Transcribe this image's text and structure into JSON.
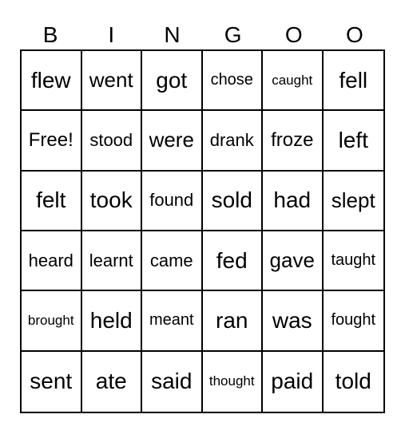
{
  "header": {
    "letters": [
      "B",
      "I",
      "N",
      "G",
      "O",
      "O"
    ]
  },
  "card": {
    "rows": [
      [
        "flew",
        "went",
        "got",
        "chose",
        "caught",
        "fell"
      ],
      [
        "Free!",
        "stood",
        "were",
        "drank",
        "froze",
        "left"
      ],
      [
        "felt",
        "took",
        "found",
        "sold",
        "had",
        "slept"
      ],
      [
        "heard",
        "learnt",
        "came",
        "fed",
        "gave",
        "taught"
      ],
      [
        "brought",
        "held",
        "meant",
        "ran",
        "was",
        "fought"
      ],
      [
        "sent",
        "ate",
        "said",
        "thought",
        "paid",
        "told"
      ]
    ]
  }
}
